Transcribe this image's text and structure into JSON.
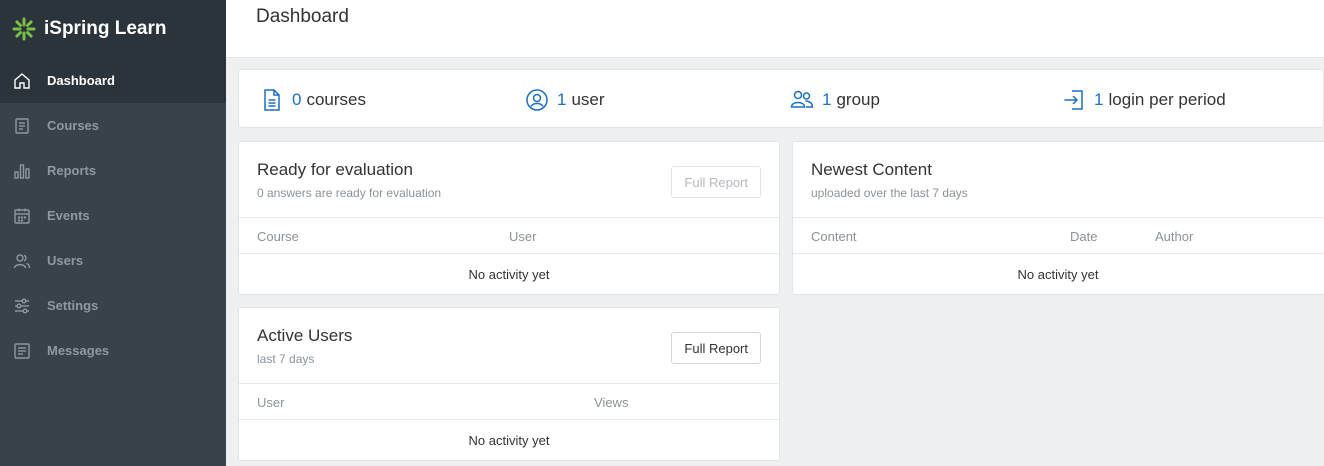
{
  "app": {
    "name": "iSpring Learn"
  },
  "sidebar": {
    "items": [
      {
        "label": "Dashboard",
        "icon": "home-icon",
        "active": true
      },
      {
        "label": "Courses",
        "icon": "courses-icon"
      },
      {
        "label": "Reports",
        "icon": "bar-chart-icon"
      },
      {
        "label": "Events",
        "icon": "calendar-icon"
      },
      {
        "label": "Users",
        "icon": "users-icon"
      },
      {
        "label": "Settings",
        "icon": "sliders-icon"
      },
      {
        "label": "Messages",
        "icon": "messages-icon"
      }
    ]
  },
  "header": {
    "title": "Dashboard"
  },
  "stats": {
    "courses": {
      "count": "0",
      "label": "courses",
      "icon": "document-icon"
    },
    "users": {
      "count": "1",
      "label": "user",
      "icon": "user-icon"
    },
    "groups": {
      "count": "1",
      "label": "group",
      "icon": "group-icon"
    },
    "logins": {
      "count": "1",
      "label": "login per period",
      "icon": "login-icon"
    }
  },
  "ready_for_evaluation": {
    "title": "Ready for evaluation",
    "subtitle": "0 answers are ready for evaluation",
    "button": "Full Report",
    "columns": [
      "Course",
      "User"
    ],
    "empty": "No activity yet"
  },
  "newest_content": {
    "title": "Newest Content",
    "subtitle": "uploaded over the last 7 days",
    "columns": [
      "Content",
      "Date",
      "Author"
    ],
    "empty": "No activity yet"
  },
  "active_users": {
    "title": "Active Users",
    "subtitle": "last 7 days",
    "button": "Full Report",
    "columns": [
      "User",
      "Views"
    ],
    "empty": "No activity yet"
  },
  "colors": {
    "accent": "#1a6fc9",
    "sidebar": "#38424b",
    "sidebar_active": "#2c343b",
    "logo": "#7ac143"
  }
}
